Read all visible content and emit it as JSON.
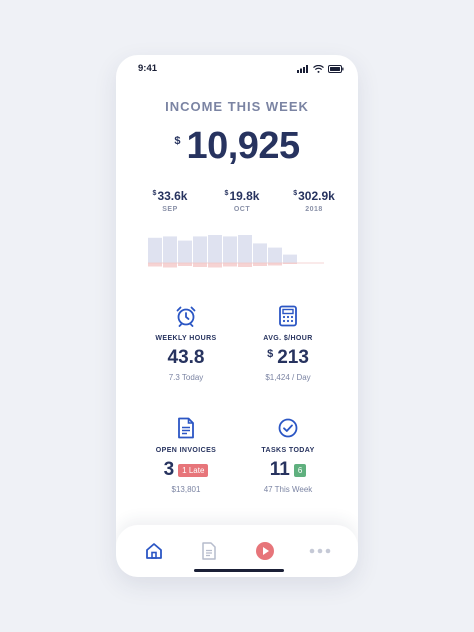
{
  "status": {
    "time": "9:41"
  },
  "income": {
    "title": "INCOME THIS WEEK",
    "currency": "$",
    "amount": "10,925"
  },
  "periods": [
    {
      "currency": "$",
      "value": "33.6k",
      "label": "SEP"
    },
    {
      "currency": "$",
      "value": "19.8k",
      "label": "OCT"
    },
    {
      "currency": "$",
      "value": "302.9k",
      "label": "2018"
    }
  ],
  "chart_data": {
    "type": "bar",
    "series": [
      {
        "values": [
          0.9,
          0.95,
          0.8,
          0.95,
          1.0,
          0.95,
          1.0,
          0.7,
          0.55,
          0.3
        ]
      },
      {
        "values": [
          0.35,
          0.45,
          0.3,
          0.4,
          0.45,
          0.35,
          0.4,
          0.3,
          0.25,
          0.1
        ]
      }
    ],
    "colors": {
      "positive": "#dfe2f0",
      "negative": "#f6d3d3"
    }
  },
  "stats": {
    "weekly_hours": {
      "label": "WEEKLY HOURS",
      "value": "43.8",
      "sub": "7.3 Today"
    },
    "avg_rate": {
      "label": "AVG. $/HOUR",
      "currency": "$",
      "value": "213",
      "sub": "$1,424 / Day"
    },
    "open_invoices": {
      "label": "OPEN INVOICES",
      "value": "3",
      "badge": "1 Late",
      "sub": "$13,801"
    },
    "tasks_today": {
      "label": "TASKS TODAY",
      "value": "11",
      "badge": "6",
      "sub": "47 This Week"
    }
  },
  "colors": {
    "accent": "#2b56c4",
    "navy": "#27335f",
    "late": "#e7757a",
    "tasks_badge": "#5fb07e",
    "play": "#e7757a"
  },
  "tabs": [
    {
      "icon": "home-icon"
    },
    {
      "icon": "document-icon"
    },
    {
      "icon": "play-icon"
    },
    {
      "icon": "more-icon"
    }
  ]
}
